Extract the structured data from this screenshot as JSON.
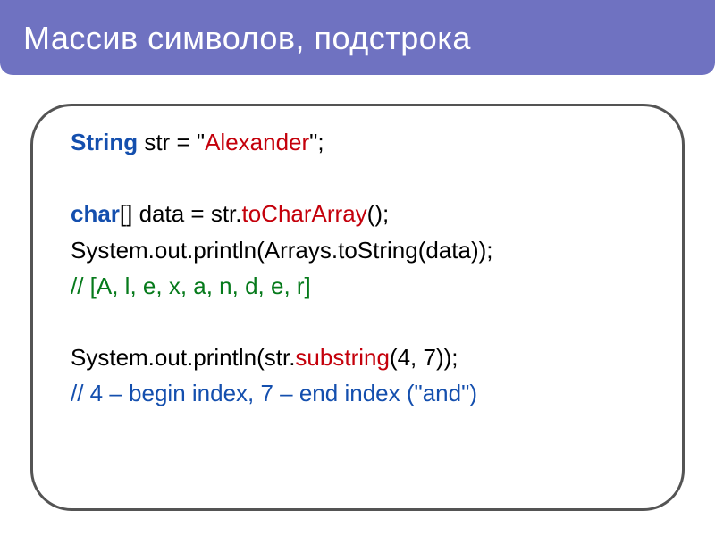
{
  "slide": {
    "title": "Массив символов, подстрока"
  },
  "code": {
    "l1": {
      "kw": "String",
      "decl": " str = ",
      "q1": "\"",
      "lit": "Alexander",
      "q2": "\"",
      "end": ";"
    },
    "l2": {
      "kw": "char",
      "arr": "[] data = str.",
      "method": "toCharArray",
      "tail": "();"
    },
    "l3": {
      "text": "System.out.println(Arrays.toString(data));"
    },
    "l4": {
      "text": "// [A, l, e, x, a, n, d, e, r]"
    },
    "l5": {
      "pre": "System.out.println(str.",
      "method": "substring",
      "tail": "(4, 7));"
    },
    "l6": {
      "text": "// 4 – begin index, 7 – end index (\"and\")"
    }
  }
}
